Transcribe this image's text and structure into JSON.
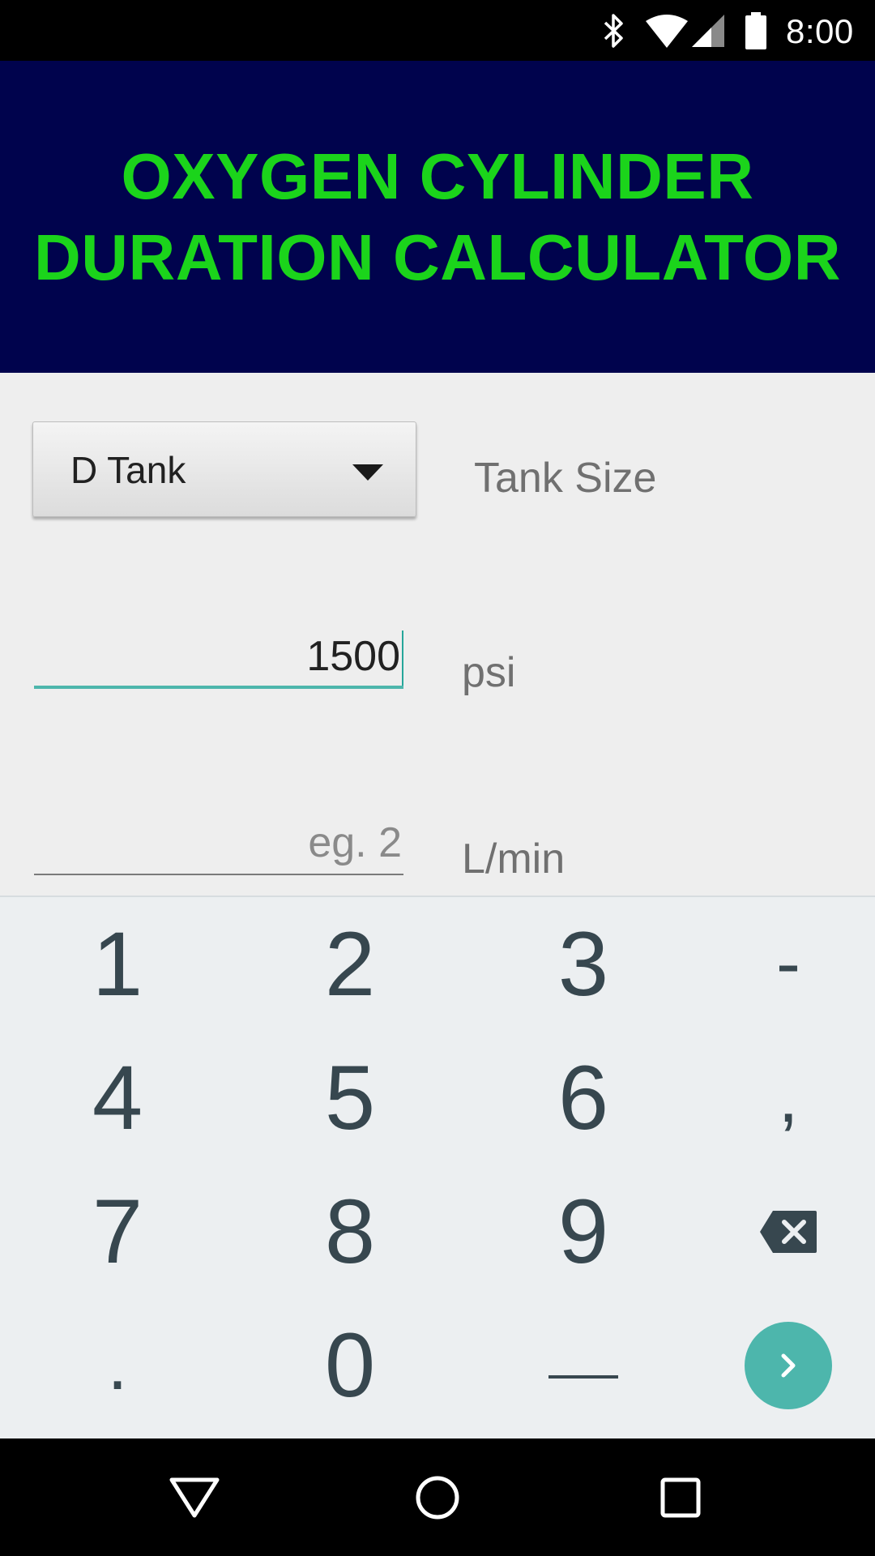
{
  "status_bar": {
    "time": "8:00",
    "icons": [
      "bluetooth-icon",
      "wifi-icon",
      "cell-signal-icon",
      "battery-icon"
    ]
  },
  "header": {
    "title": "OXYGEN CYLINDER\nDURATION CALCULATOR",
    "background_color": "#00034d",
    "text_color": "#1bd41b"
  },
  "form": {
    "tank": {
      "selected": "D Tank",
      "label": "Tank Size"
    },
    "pressure": {
      "value": "1500",
      "label": "psi"
    },
    "flow_rate": {
      "value": "",
      "placeholder": "eg. 2",
      "label": "L/min"
    },
    "accent_color": "#4db6ac"
  },
  "keyboard": {
    "rows": [
      [
        "1",
        "2",
        "3",
        "-"
      ],
      [
        "4",
        "5",
        "6",
        ","
      ],
      [
        "7",
        "8",
        "9",
        "backspace"
      ],
      [
        ".",
        "0",
        "space",
        "next"
      ]
    ],
    "key_color": "#37474f",
    "background_color": "#eceff1"
  },
  "nav_bar": {
    "buttons": [
      "back-icon",
      "home-icon",
      "recents-icon"
    ]
  }
}
